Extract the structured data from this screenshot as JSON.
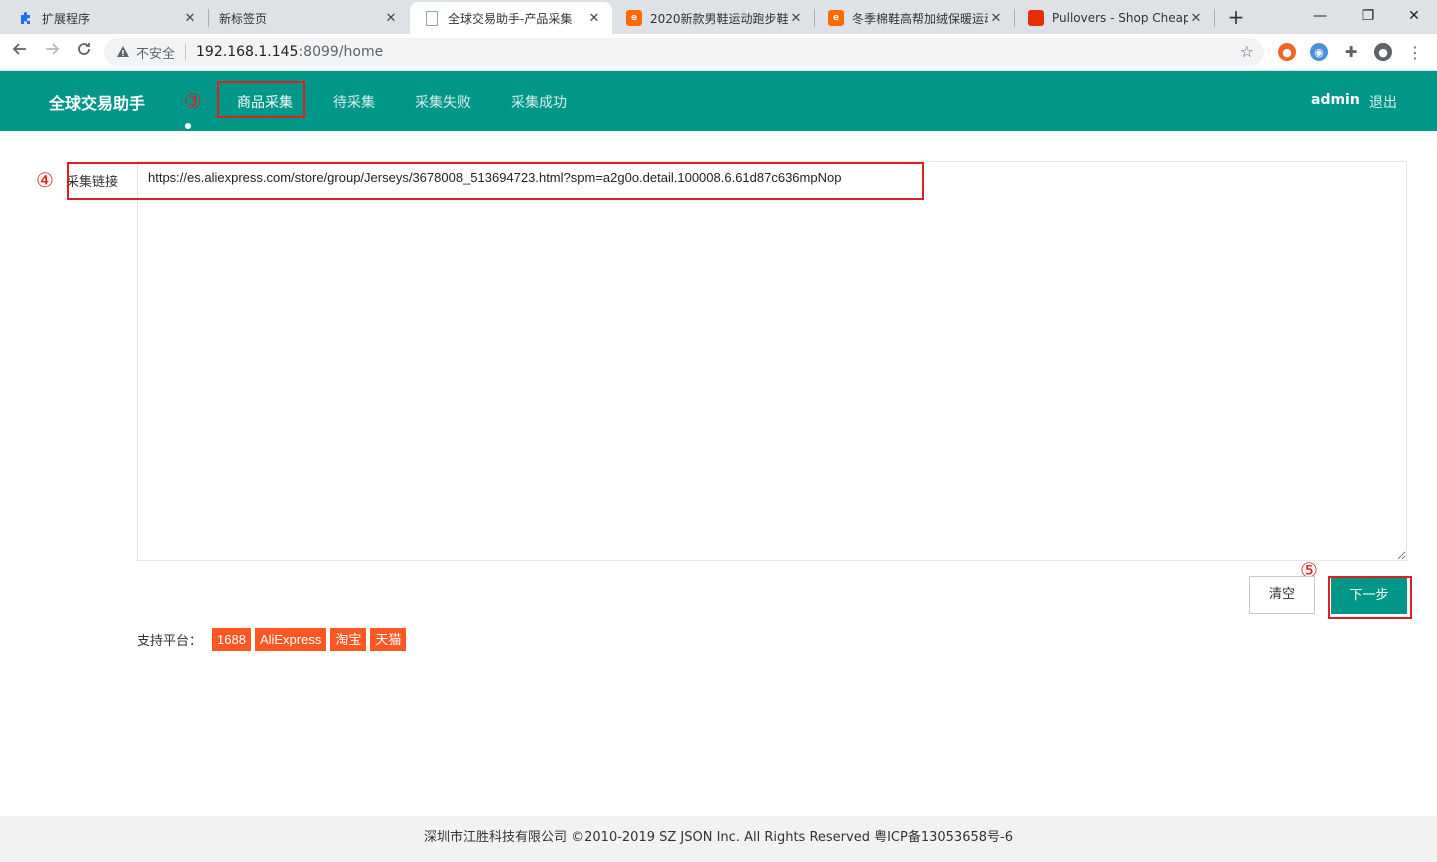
{
  "browser": {
    "tabs": [
      {
        "title": "扩展程序",
        "icon": "puzzle-icon",
        "active": false
      },
      {
        "title": "新标签页",
        "icon": "none",
        "active": false
      },
      {
        "title": "全球交易助手-产品采集",
        "icon": "document-icon",
        "active": true
      },
      {
        "title": "2020新款男鞋运动跑步鞋",
        "icon": "alibaba-icon",
        "active": false
      },
      {
        "title": "冬季棉鞋高帮加绒保暖运动",
        "icon": "alibaba-icon",
        "active": false
      },
      {
        "title": "Pullovers - Shop Cheap",
        "icon": "aliexpress-icon",
        "active": false
      }
    ],
    "close_glyph": "✕",
    "new_tab_glyph": "+",
    "window_controls": {
      "minimize": "—",
      "restore": "❐",
      "close": "✕"
    },
    "address": {
      "security_label": "不安全",
      "host": "192.168.1.145",
      "path": ":8099/home"
    }
  },
  "app": {
    "brand": "全球交易助手",
    "nav": [
      {
        "label": "商品采集",
        "active": true
      },
      {
        "label": "待采集",
        "active": false
      },
      {
        "label": "采集失败",
        "active": false
      },
      {
        "label": "采集成功",
        "active": false
      }
    ],
    "user": "admin",
    "logout": "退出"
  },
  "annotations": {
    "step3": "③",
    "step4": "④",
    "step5": "⑤"
  },
  "form": {
    "label": "采集链接",
    "url_value": "https://es.aliexpress.com/store/group/Jerseys/3678008_513694723.html?spm=a2g0o.detail.100008.6.61d87c636mpNop",
    "clear_label": "清空",
    "next_label": "下一步"
  },
  "platforms": {
    "label": "支持平台：",
    "items": [
      "1688",
      "AliExpress",
      "淘宝",
      "天猫"
    ]
  },
  "footer": "深圳市江胜科技有限公司 ©2010-2019 SZ JSON Inc. All Rights Reserved 粤ICP备13053658号-6",
  "colors": {
    "primary": "#009688",
    "tag": "#ff5722",
    "annotation": "#e02020"
  }
}
